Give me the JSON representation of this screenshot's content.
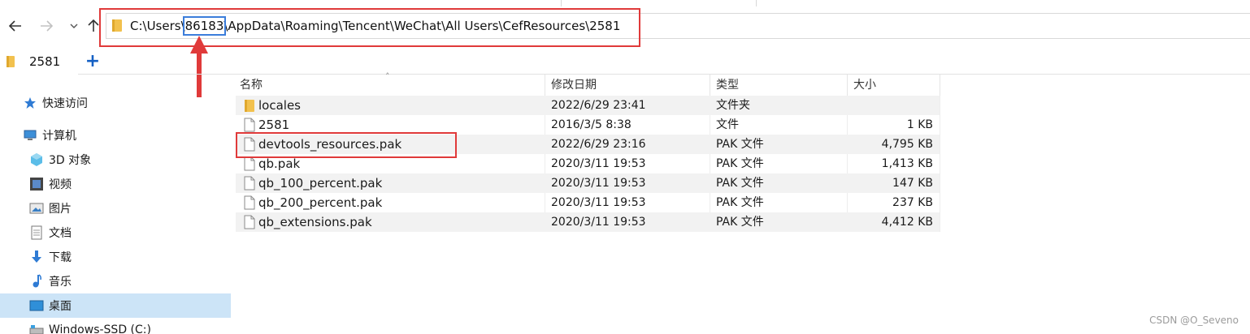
{
  "address": {
    "segments": [
      "C:\\Users\\",
      "86183",
      "\\AppData\\Roaming\\Tencent\\WeChat\\All Users\\CefResources\\2581"
    ]
  },
  "tab": {
    "label": "2581",
    "add_label": "+"
  },
  "sidebar": {
    "items": [
      {
        "label": "快速访问",
        "icon": "star-icon"
      },
      {
        "label": "计算机",
        "icon": "computer-icon"
      },
      {
        "label": "3D 对象",
        "icon": "3d-objects-icon"
      },
      {
        "label": "视频",
        "icon": "video-icon"
      },
      {
        "label": "图片",
        "icon": "pictures-icon"
      },
      {
        "label": "文档",
        "icon": "documents-icon"
      },
      {
        "label": "下载",
        "icon": "download-icon"
      },
      {
        "label": "音乐",
        "icon": "music-icon"
      },
      {
        "label": "桌面",
        "icon": "desktop-icon",
        "selected": true
      },
      {
        "label": "Windows-SSD (C:)",
        "icon": "drive-icon"
      }
    ]
  },
  "columns": {
    "name": "名称",
    "modified": "修改日期",
    "type": "类型",
    "size": "大小"
  },
  "files": [
    {
      "name": "locales",
      "modified": "2022/6/29 23:41",
      "type": "文件夹",
      "size": "",
      "icon": "folder-icon"
    },
    {
      "name": "2581",
      "modified": "2016/3/5 8:38",
      "type": "文件",
      "size": "1 KB",
      "icon": "file-icon"
    },
    {
      "name": "devtools_resources.pak",
      "modified": "2022/6/29 23:16",
      "type": "PAK 文件",
      "size": "4,795 KB",
      "icon": "file-icon",
      "highlighted": true
    },
    {
      "name": "qb.pak",
      "modified": "2020/3/11 19:53",
      "type": "PAK 文件",
      "size": "1,413 KB",
      "icon": "file-icon"
    },
    {
      "name": "qb_100_percent.pak",
      "modified": "2020/3/11 19:53",
      "type": "PAK 文件",
      "size": "147 KB",
      "icon": "file-icon"
    },
    {
      "name": "qb_200_percent.pak",
      "modified": "2020/3/11 19:53",
      "type": "PAK 文件",
      "size": "237 KB",
      "icon": "file-icon"
    },
    {
      "name": "qb_extensions.pak",
      "modified": "2020/3/11 19:53",
      "type": "PAK 文件",
      "size": "4,412 KB",
      "icon": "file-icon"
    }
  ],
  "watermark": "CSDN @O_Seveno",
  "colors": {
    "annotation_red": "#e03a3a",
    "annotation_blue": "#3b7ddb",
    "selected_bg": "#cce4f7",
    "folder_yellow": "#f2c14e"
  }
}
